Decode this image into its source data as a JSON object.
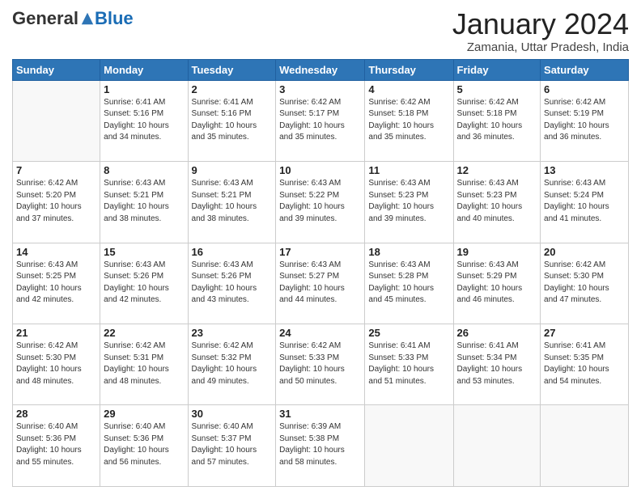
{
  "header": {
    "logo_general": "General",
    "logo_blue": "Blue",
    "month_title": "January 2024",
    "location": "Zamania, Uttar Pradesh, India"
  },
  "weekdays": [
    "Sunday",
    "Monday",
    "Tuesday",
    "Wednesday",
    "Thursday",
    "Friday",
    "Saturday"
  ],
  "weeks": [
    [
      {
        "day": "",
        "info": ""
      },
      {
        "day": "1",
        "info": "Sunrise: 6:41 AM\nSunset: 5:16 PM\nDaylight: 10 hours\nand 34 minutes."
      },
      {
        "day": "2",
        "info": "Sunrise: 6:41 AM\nSunset: 5:16 PM\nDaylight: 10 hours\nand 35 minutes."
      },
      {
        "day": "3",
        "info": "Sunrise: 6:42 AM\nSunset: 5:17 PM\nDaylight: 10 hours\nand 35 minutes."
      },
      {
        "day": "4",
        "info": "Sunrise: 6:42 AM\nSunset: 5:18 PM\nDaylight: 10 hours\nand 35 minutes."
      },
      {
        "day": "5",
        "info": "Sunrise: 6:42 AM\nSunset: 5:18 PM\nDaylight: 10 hours\nand 36 minutes."
      },
      {
        "day": "6",
        "info": "Sunrise: 6:42 AM\nSunset: 5:19 PM\nDaylight: 10 hours\nand 36 minutes."
      }
    ],
    [
      {
        "day": "7",
        "info": "Sunrise: 6:42 AM\nSunset: 5:20 PM\nDaylight: 10 hours\nand 37 minutes."
      },
      {
        "day": "8",
        "info": "Sunrise: 6:43 AM\nSunset: 5:21 PM\nDaylight: 10 hours\nand 38 minutes."
      },
      {
        "day": "9",
        "info": "Sunrise: 6:43 AM\nSunset: 5:21 PM\nDaylight: 10 hours\nand 38 minutes."
      },
      {
        "day": "10",
        "info": "Sunrise: 6:43 AM\nSunset: 5:22 PM\nDaylight: 10 hours\nand 39 minutes."
      },
      {
        "day": "11",
        "info": "Sunrise: 6:43 AM\nSunset: 5:23 PM\nDaylight: 10 hours\nand 39 minutes."
      },
      {
        "day": "12",
        "info": "Sunrise: 6:43 AM\nSunset: 5:23 PM\nDaylight: 10 hours\nand 40 minutes."
      },
      {
        "day": "13",
        "info": "Sunrise: 6:43 AM\nSunset: 5:24 PM\nDaylight: 10 hours\nand 41 minutes."
      }
    ],
    [
      {
        "day": "14",
        "info": "Sunrise: 6:43 AM\nSunset: 5:25 PM\nDaylight: 10 hours\nand 42 minutes."
      },
      {
        "day": "15",
        "info": "Sunrise: 6:43 AM\nSunset: 5:26 PM\nDaylight: 10 hours\nand 42 minutes."
      },
      {
        "day": "16",
        "info": "Sunrise: 6:43 AM\nSunset: 5:26 PM\nDaylight: 10 hours\nand 43 minutes."
      },
      {
        "day": "17",
        "info": "Sunrise: 6:43 AM\nSunset: 5:27 PM\nDaylight: 10 hours\nand 44 minutes."
      },
      {
        "day": "18",
        "info": "Sunrise: 6:43 AM\nSunset: 5:28 PM\nDaylight: 10 hours\nand 45 minutes."
      },
      {
        "day": "19",
        "info": "Sunrise: 6:43 AM\nSunset: 5:29 PM\nDaylight: 10 hours\nand 46 minutes."
      },
      {
        "day": "20",
        "info": "Sunrise: 6:42 AM\nSunset: 5:30 PM\nDaylight: 10 hours\nand 47 minutes."
      }
    ],
    [
      {
        "day": "21",
        "info": "Sunrise: 6:42 AM\nSunset: 5:30 PM\nDaylight: 10 hours\nand 48 minutes."
      },
      {
        "day": "22",
        "info": "Sunrise: 6:42 AM\nSunset: 5:31 PM\nDaylight: 10 hours\nand 48 minutes."
      },
      {
        "day": "23",
        "info": "Sunrise: 6:42 AM\nSunset: 5:32 PM\nDaylight: 10 hours\nand 49 minutes."
      },
      {
        "day": "24",
        "info": "Sunrise: 6:42 AM\nSunset: 5:33 PM\nDaylight: 10 hours\nand 50 minutes."
      },
      {
        "day": "25",
        "info": "Sunrise: 6:41 AM\nSunset: 5:33 PM\nDaylight: 10 hours\nand 51 minutes."
      },
      {
        "day": "26",
        "info": "Sunrise: 6:41 AM\nSunset: 5:34 PM\nDaylight: 10 hours\nand 53 minutes."
      },
      {
        "day": "27",
        "info": "Sunrise: 6:41 AM\nSunset: 5:35 PM\nDaylight: 10 hours\nand 54 minutes."
      }
    ],
    [
      {
        "day": "28",
        "info": "Sunrise: 6:40 AM\nSunset: 5:36 PM\nDaylight: 10 hours\nand 55 minutes."
      },
      {
        "day": "29",
        "info": "Sunrise: 6:40 AM\nSunset: 5:36 PM\nDaylight: 10 hours\nand 56 minutes."
      },
      {
        "day": "30",
        "info": "Sunrise: 6:40 AM\nSunset: 5:37 PM\nDaylight: 10 hours\nand 57 minutes."
      },
      {
        "day": "31",
        "info": "Sunrise: 6:39 AM\nSunset: 5:38 PM\nDaylight: 10 hours\nand 58 minutes."
      },
      {
        "day": "",
        "info": ""
      },
      {
        "day": "",
        "info": ""
      },
      {
        "day": "",
        "info": ""
      }
    ]
  ]
}
